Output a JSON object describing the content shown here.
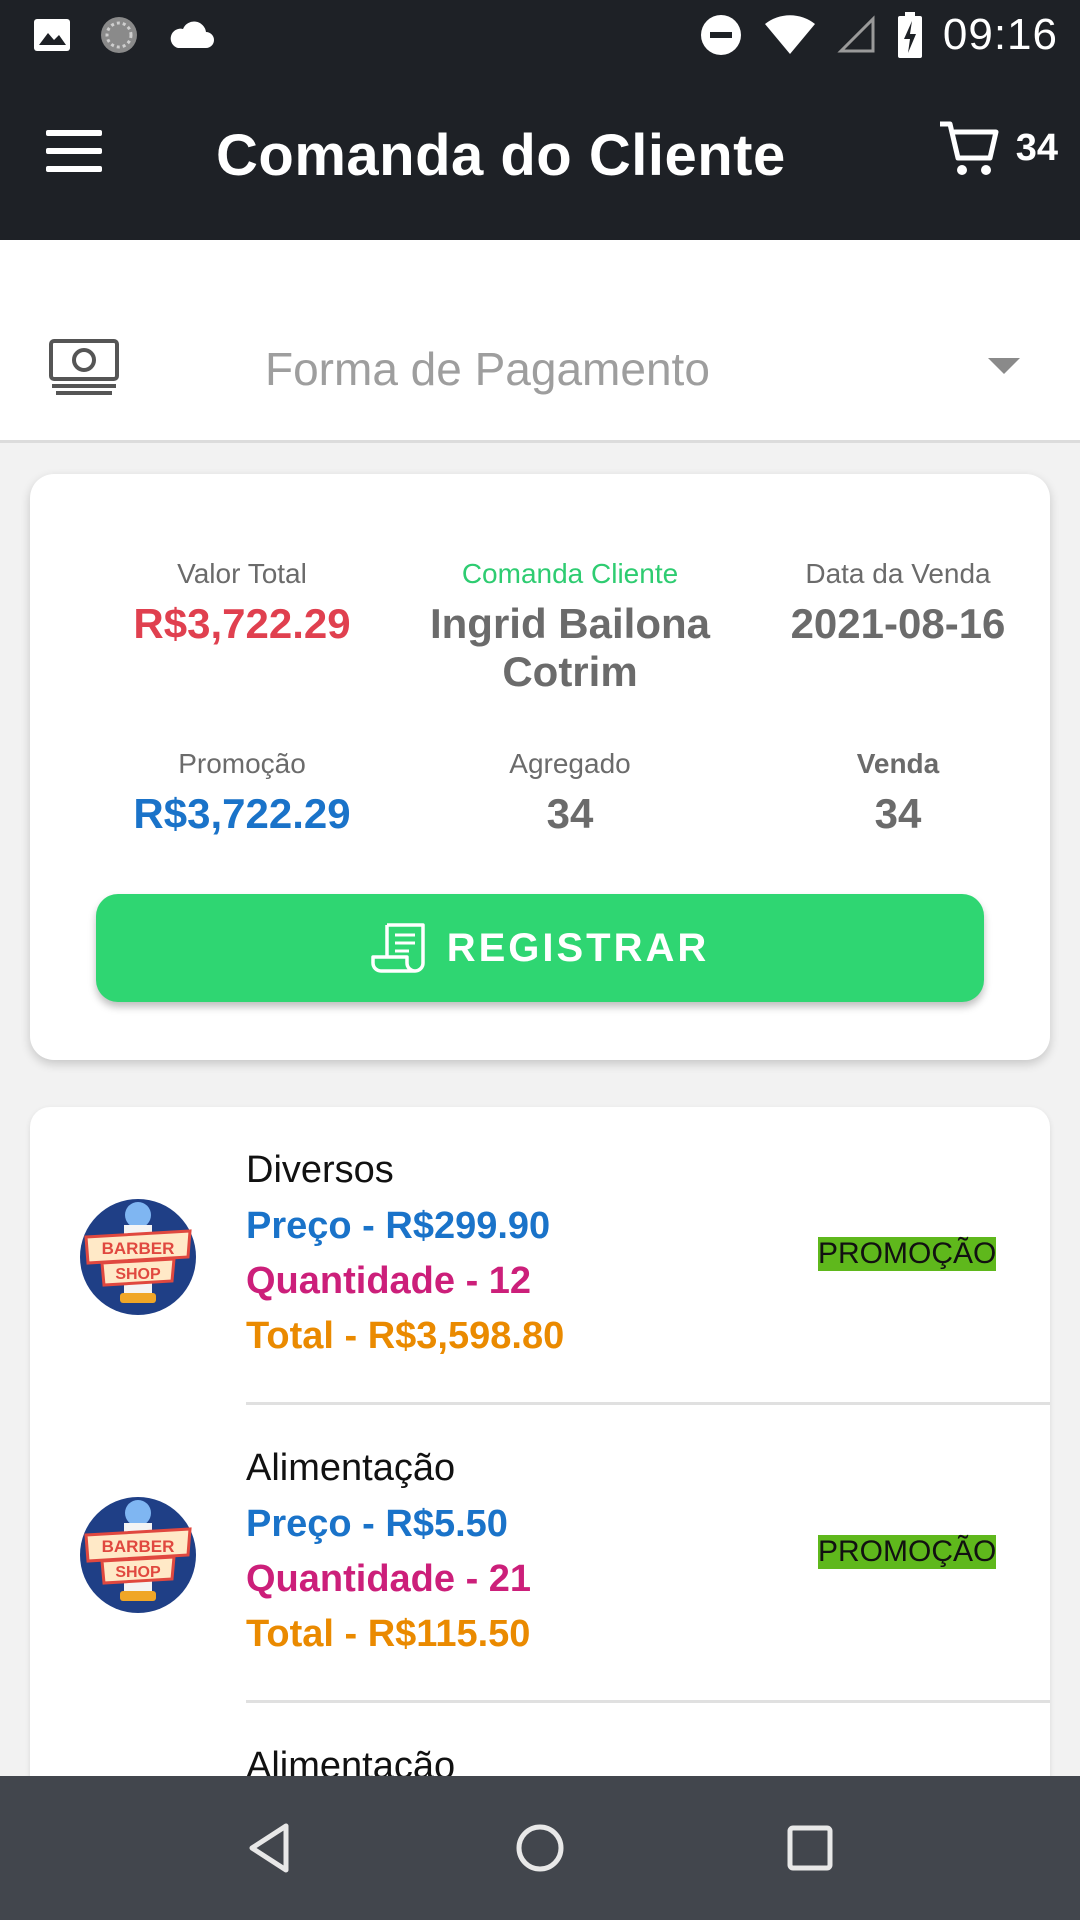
{
  "status_bar": {
    "time": "09:16",
    "icons": [
      "image-icon",
      "sync-icon",
      "cloud-icon",
      "do-not-disturb-icon",
      "wifi-icon",
      "signal-icon",
      "battery-charging-icon"
    ]
  },
  "app_bar": {
    "title": "Comanda do Cliente",
    "cart_count": "34"
  },
  "payment": {
    "placeholder": "Forma de Pagamento"
  },
  "summary": {
    "valor_total_label": "Valor Total",
    "valor_total": "R$3,722.29",
    "comanda_label": "Comanda Cliente",
    "cliente_nome": "Ingrid Bailona Cotrim",
    "data_label": "Data da Venda",
    "data_valor": "2021-08-16",
    "promocao_label": "Promoção",
    "promocao_valor": "R$3,722.29",
    "agregado_label": "Agregado",
    "agregado_valor": "34",
    "venda_label": "Venda",
    "venda_valor": "34",
    "register_button": "REGISTRAR"
  },
  "items": [
    {
      "name": "Diversos",
      "price": "Preço - R$299.90",
      "quantity": "Quantidade - 12",
      "total": "Total - R$3,598.80",
      "badge": "PROMOÇÃO"
    },
    {
      "name": "Alimentação",
      "price": "Preço - R$5.50",
      "quantity": "Quantidade - 21",
      "total": "Total - R$115.50",
      "badge": "PROMOÇÃO"
    },
    {
      "name": "Alimentação"
    }
  ],
  "logo_text": [
    "BARBER",
    "SHOP"
  ],
  "colors": {
    "bar_dark": "#1e2126",
    "accent_green": "#2fd672",
    "price_blue": "#1a73c9",
    "quantity_magenta": "#cc1f7a",
    "total_orange": "#ea8a00",
    "total_red": "#e0404f",
    "promo_badge": "#5fb81c"
  }
}
